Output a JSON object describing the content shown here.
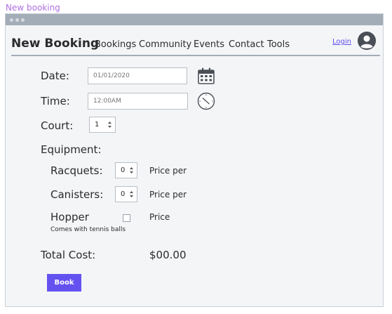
{
  "window": {
    "title": "New booking"
  },
  "nav": {
    "brand": "New Booking",
    "links": [
      "Bookings",
      "Community",
      "Events",
      "Contact",
      "Tools"
    ],
    "login": "Login",
    "avatar_icon": "user-avatar-icon"
  },
  "form": {
    "date": {
      "label": "Date:",
      "placeholder": "01/01/2020",
      "icon": "calendar-icon"
    },
    "time": {
      "label": "Time:",
      "placeholder": "12:00AM",
      "icon": "clock-icon"
    },
    "court": {
      "label": "Court:",
      "value": "1"
    },
    "equipment": {
      "label": "Equipment:",
      "racquets": {
        "label": "Racquets:",
        "value": "0",
        "price": "Price per"
      },
      "canisters": {
        "label": "Canisters:",
        "value": "0",
        "price": "Price per"
      },
      "hopper": {
        "label": "Hopper",
        "checked": false,
        "price": "Price",
        "note": "Comes with tennis balls"
      }
    },
    "total": {
      "label": "Total Cost:",
      "value": "$00.00"
    },
    "submit_label": "Book"
  },
  "colors": {
    "accent": "#6452f0",
    "window_bar": "#a3adb8",
    "title_purple": "#b06fe0",
    "background": "#f4f5f7"
  }
}
